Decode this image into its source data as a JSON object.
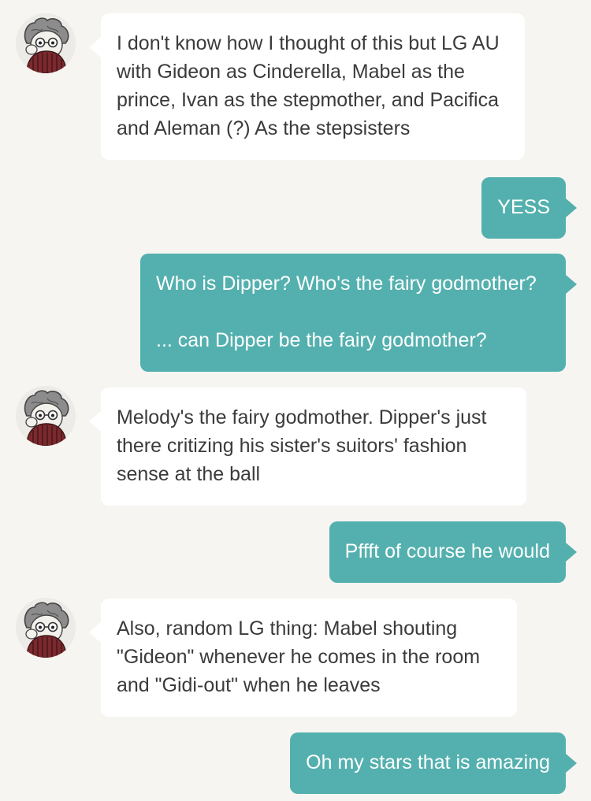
{
  "colors": {
    "background": "#f6f5f1",
    "incoming_bubble": "#ffffff",
    "outgoing_bubble": "#54b0ae",
    "incoming_text": "#3b3b3b",
    "outgoing_text": "#ffffff"
  },
  "avatar_icon": "cartoon-character-avatar-icon",
  "messages": [
    {
      "direction": "incoming",
      "text": "I don't know how I thought of this but LG AU with Gideon as Cinderella, Mabel as the prince, Ivan as the stepmother, and Pacifica and Aleman (?) As the stepsisters"
    },
    {
      "direction": "outgoing",
      "text": "YESS"
    },
    {
      "direction": "outgoing",
      "text": "Who is Dipper? Who's the fairy godmother?\n\n... can Dipper be the fairy godmother?"
    },
    {
      "direction": "incoming",
      "text": "Melody's the fairy godmother. Dipper's just there critizing his sister's suitors' fashion sense at the ball"
    },
    {
      "direction": "outgoing",
      "text": "Pffft of course he would"
    },
    {
      "direction": "incoming",
      "text": "Also, random LG thing: Mabel shouting \"Gideon\" whenever he comes in the room and \"Gidi-out\" when he leaves"
    },
    {
      "direction": "outgoing",
      "text": "Oh my stars that is amazing"
    }
  ]
}
